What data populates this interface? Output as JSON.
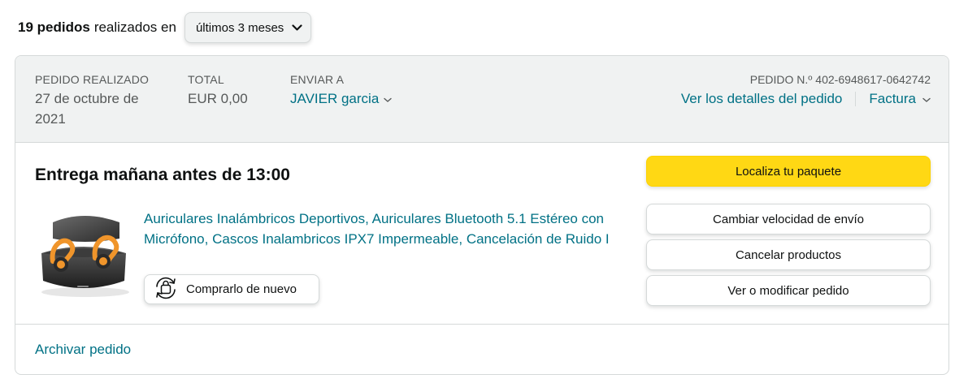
{
  "summary": {
    "count": "19 pedidos",
    "text": "realizados en",
    "range_selected": "últimos 3 meses"
  },
  "order": {
    "placed_caption": "PEDIDO REALIZADO",
    "placed_date": "27 de octubre de 2021",
    "total_caption": "TOTAL",
    "total_value": "EUR 0,00",
    "ship_caption": "ENVIAR A",
    "ship_name": "JAVIER garcia",
    "order_number": "PEDIDO N.º 402-6948617-0642742",
    "details_link": "Ver los detalles del pedido",
    "invoice_link": "Factura",
    "delivery_title": "Entrega mañana antes de 13:00",
    "product_title": "Auriculares Inalámbricos Deportivos, Auriculares Bluetooth 5.1 Estéreo con Micrófono, Cascos Inalambricos IPX7 Impermeable, Cancelación de Ruido I",
    "buy_again": "Comprarlo de nuevo",
    "archive_link": "Archivar pedido"
  },
  "actions": {
    "track": "Localiza tu paquete",
    "change_speed": "Cambiar velocidad de envío",
    "cancel": "Cancelar productos",
    "modify": "Ver o modificar pedido"
  },
  "colors": {
    "link": "#007185",
    "primary_button": "#FFD814",
    "header_bg": "#F0F2F2"
  },
  "icons": {
    "range_chevron": "chevron-down-icon",
    "ship_chevron": "chevron-down-icon",
    "invoice_chevron": "chevron-down-icon",
    "buy_again": "buy-again-icon"
  }
}
